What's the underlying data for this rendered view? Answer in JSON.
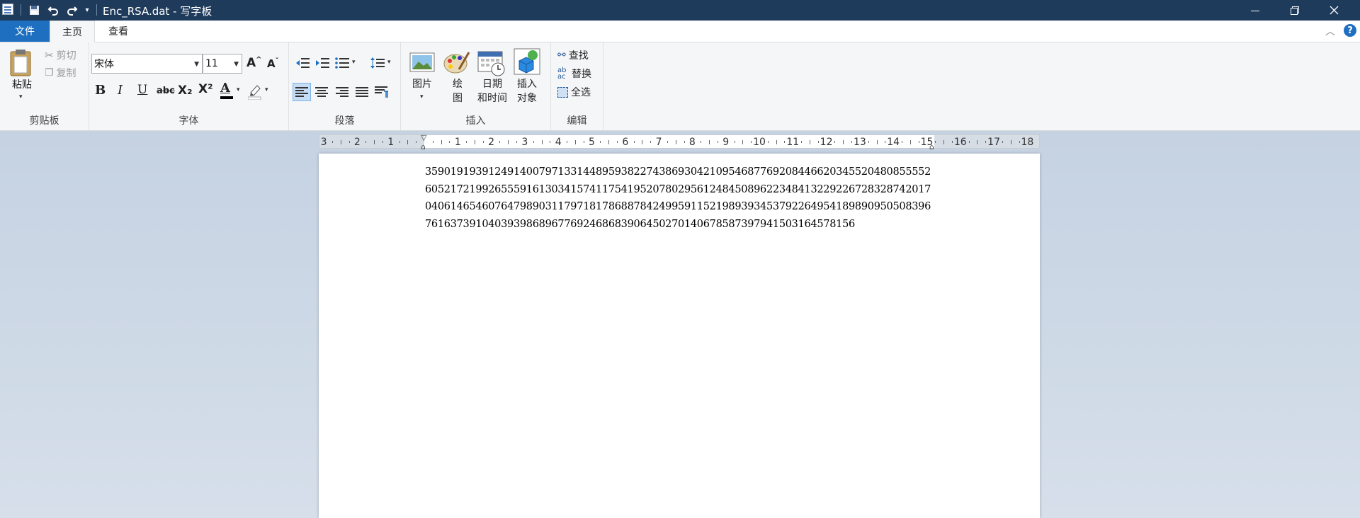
{
  "window": {
    "title": "Enc_RSA.dat - 写字板",
    "min_icon": "minimize-icon",
    "max_icon": "restore-icon",
    "close_icon": "close-icon"
  },
  "quick_access": {
    "save_icon": "save-icon",
    "undo_icon": "undo-icon",
    "redo_icon": "redo-icon",
    "customize_icon": "customize-dropdown-icon"
  },
  "tabs": [
    {
      "label": "文件"
    },
    {
      "label": "主页"
    },
    {
      "label": "查看"
    }
  ],
  "ribbon": {
    "clipboard": {
      "label": "剪贴板",
      "paste": "粘贴",
      "cut": "剪切",
      "copy": "复制"
    },
    "font": {
      "label": "字体",
      "family": "宋体",
      "size": "11",
      "bold": "B",
      "italic": "I",
      "underline": "U",
      "strike": "abc",
      "subscript": "X₂",
      "superscript": "X²",
      "font_color": "A"
    },
    "paragraph": {
      "label": "段落"
    },
    "insert": {
      "label": "插入",
      "picture": "图片",
      "paint_1": "绘",
      "paint_2": "图",
      "datetime_1": "日期",
      "datetime_2": "和时间",
      "object_1": "插入",
      "object_2": "对象"
    },
    "editing": {
      "label": "编辑",
      "find": "查找",
      "replace": "替换",
      "select_all": "全选"
    }
  },
  "ruler": {
    "labels": [
      "3",
      "2",
      "1",
      "1",
      "2",
      "3",
      "4",
      "5",
      "6",
      "7",
      "8",
      "9",
      "10",
      "11",
      "12",
      "13",
      "14",
      "15",
      "16",
      "17",
      "18"
    ]
  },
  "document": {
    "lines": [
      "3590191939124914007971331448959382274386930421095468776920844662034552048085555​2",
      "6052172199265559161303415741175419520780295612484508962234841322922672832874201​7",
      "0406146546076479890311797181786887842499591152198939345379226495418989095050839​6",
      "76163739104039398689677692468683906450270140678587397941503164578156"
    ]
  }
}
